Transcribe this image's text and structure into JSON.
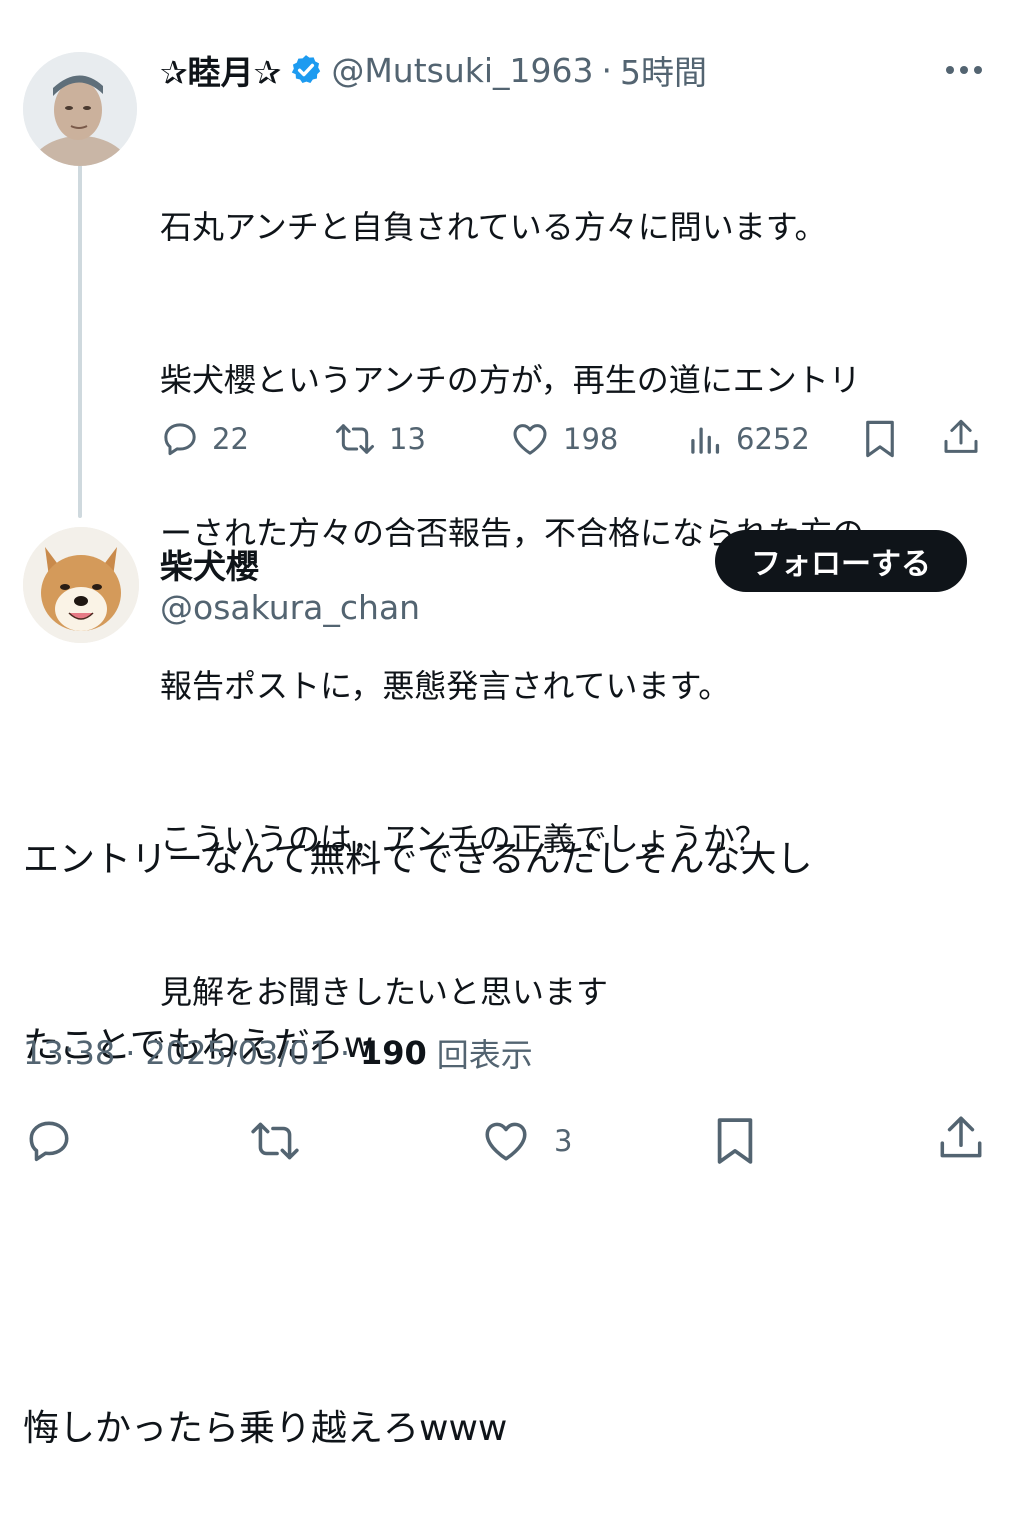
{
  "original_post": {
    "author_name": "✰睦月✰",
    "verified_icon": "verified-badge-icon",
    "handle": "@Mutsuki_1963",
    "separator": "·",
    "time_ago": "5時間",
    "more_icon": "more-icon",
    "lines": [
      "石丸アンチと自負されている方々に問います。",
      "柴犬櫻というアンチの方が，再生の道にエントリ",
      "ーされた方々の合否報告，不合格になられた方の",
      "報告ポストに，悪態発言されています。",
      "こういうのは，アンチの正義でしょうか？",
      "見解をお聞きしたいと思います"
    ],
    "stats": {
      "replies": "22",
      "reposts": "13",
      "likes": "198",
      "views": "6252"
    }
  },
  "reply_post": {
    "author_name": "柴犬櫻",
    "handle": "@osakura_chan",
    "follow_label": "フォローする",
    "lines": [
      "エントリーなんて無料でできるんだしそんな大し",
      "たことでもねえだろw",
      "",
      "悔しかったら乗り越えろwww"
    ],
    "meta": {
      "time": "13:38",
      "sep1": "·",
      "date": "2025/03/01",
      "sep2": "·",
      "views": "190",
      "views_label": "回表示"
    },
    "stats": {
      "likes": "3"
    }
  },
  "colors": {
    "text": "#0f1419",
    "secondary": "#536471",
    "verified": "#1d9bf0",
    "thread_line": "#cfd9de"
  }
}
